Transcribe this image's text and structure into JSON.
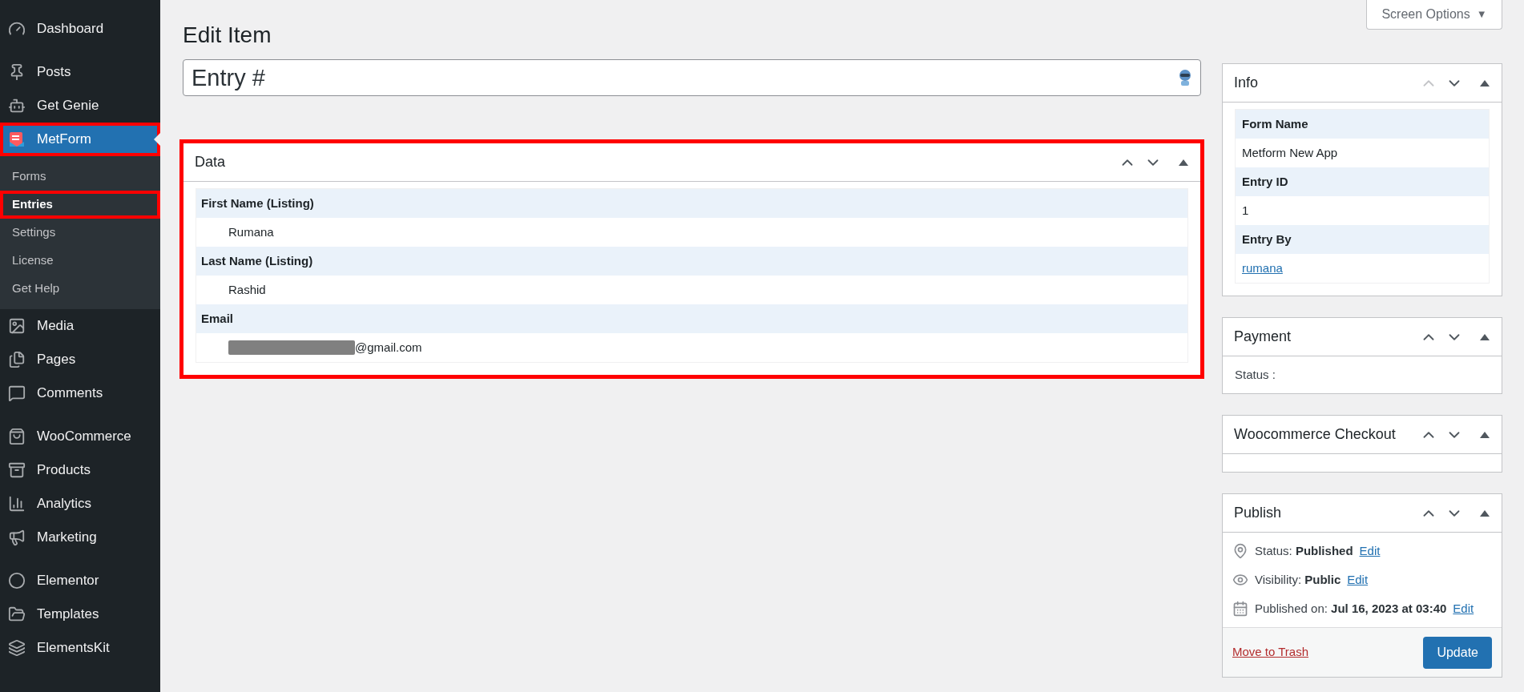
{
  "sidebar": {
    "sections": [
      {
        "items": [
          {
            "label": "Dashboard",
            "selected": false,
            "annotated": false
          }
        ]
      },
      {
        "items": [
          {
            "label": "Posts",
            "selected": false,
            "annotated": false
          },
          {
            "label": "Get Genie",
            "selected": false,
            "annotated": false
          },
          {
            "label": "MetForm",
            "selected": true,
            "annotated": true,
            "children": [
              {
                "label": "Forms",
                "selected": false,
                "annotated": false
              },
              {
                "label": "Entries",
                "selected": true,
                "annotated": true
              },
              {
                "label": "Settings",
                "selected": false,
                "annotated": false
              },
              {
                "label": "License",
                "selected": false,
                "annotated": false
              },
              {
                "label": "Get Help",
                "selected": false,
                "annotated": false
              }
            ]
          },
          {
            "label": "Media",
            "selected": false,
            "annotated": false
          },
          {
            "label": "Pages",
            "selected": false,
            "annotated": false
          },
          {
            "label": "Comments",
            "selected": false,
            "annotated": false
          }
        ]
      },
      {
        "items": [
          {
            "label": "WooCommerce",
            "selected": false,
            "annotated": false
          },
          {
            "label": "Products",
            "selected": false,
            "annotated": false
          },
          {
            "label": "Analytics",
            "selected": false,
            "annotated": false
          },
          {
            "label": "Marketing",
            "selected": false,
            "annotated": false
          }
        ]
      },
      {
        "items": [
          {
            "label": "Elementor",
            "selected": false,
            "annotated": false
          },
          {
            "label": "Templates",
            "selected": false,
            "annotated": false
          },
          {
            "label": "ElementsKit",
            "selected": false,
            "annotated": false
          }
        ]
      }
    ]
  },
  "screen_options": {
    "label": "Screen Options",
    "caret": "▼"
  },
  "page_title": "Edit Item",
  "title_field": {
    "value": "Entry #"
  },
  "data_panel": {
    "title": "Data",
    "annotated": true,
    "move_up_disabled": false,
    "rows": [
      {
        "label": "First Name (Listing)",
        "value": "Rumana",
        "redacted": false
      },
      {
        "label": "Last Name (Listing)",
        "value": "Rashid",
        "redacted": false
      },
      {
        "label": "Email",
        "value": "@gmail.com",
        "redacted": true
      }
    ]
  },
  "info_panel": {
    "title": "Info",
    "move_up_disabled": true,
    "fields": [
      {
        "label": "Form Name",
        "value": "Metform New App",
        "kind": "text"
      },
      {
        "label": "Entry ID",
        "value": "1",
        "kind": "text"
      },
      {
        "label": "Entry By",
        "value": "rumana",
        "kind": "link"
      }
    ]
  },
  "payment_panel": {
    "title": "Payment",
    "move_up_disabled": false,
    "status": "Status :"
  },
  "woo_panel": {
    "title": "Woocommerce Checkout",
    "move_up_disabled": false
  },
  "publish_panel": {
    "title": "Publish",
    "move_up_disabled": false,
    "rows": [
      {
        "label": "Status:",
        "value": "Published",
        "link": "Edit"
      },
      {
        "label": "Visibility:",
        "value": "Public",
        "link": "Edit"
      },
      {
        "label": "Published on:",
        "value": "Jul 16, 2023 at 03:40",
        "link": "Edit"
      }
    ],
    "trash": "Move to Trash",
    "update": "Update"
  }
}
